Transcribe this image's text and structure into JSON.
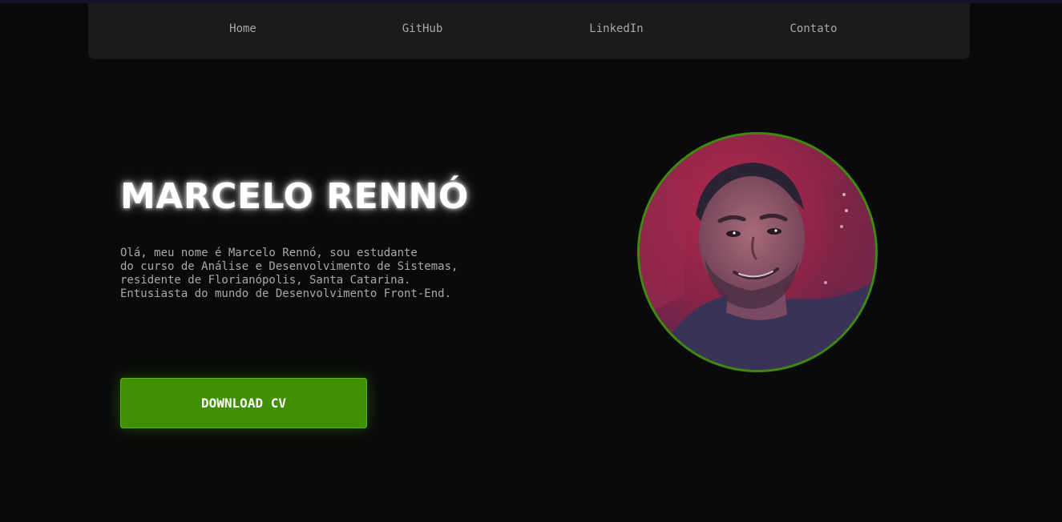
{
  "nav": {
    "items": [
      {
        "label": "Home"
      },
      {
        "label": "GitHub"
      },
      {
        "label": "LinkedIn"
      },
      {
        "label": "Contato"
      }
    ]
  },
  "hero": {
    "title": "MARCELO RENNÓ",
    "description_lines": [
      "Olá, meu nome é Marcelo Rennó, sou estudante",
      "do curso de Análise e Desenvolvimento de Sistemas,",
      "residente de Florianópolis, Santa Catarina.",
      "Entusiasta do mundo de Desenvolvimento Front-End."
    ],
    "download_label": "DOWNLOAD CV"
  },
  "colors": {
    "background": "#0a0a0a",
    "navbar": "#1b1b1b",
    "accent_green": "#3f8f00",
    "nav_text": "#a8a8a8",
    "body_text": "#a9a9a9"
  }
}
